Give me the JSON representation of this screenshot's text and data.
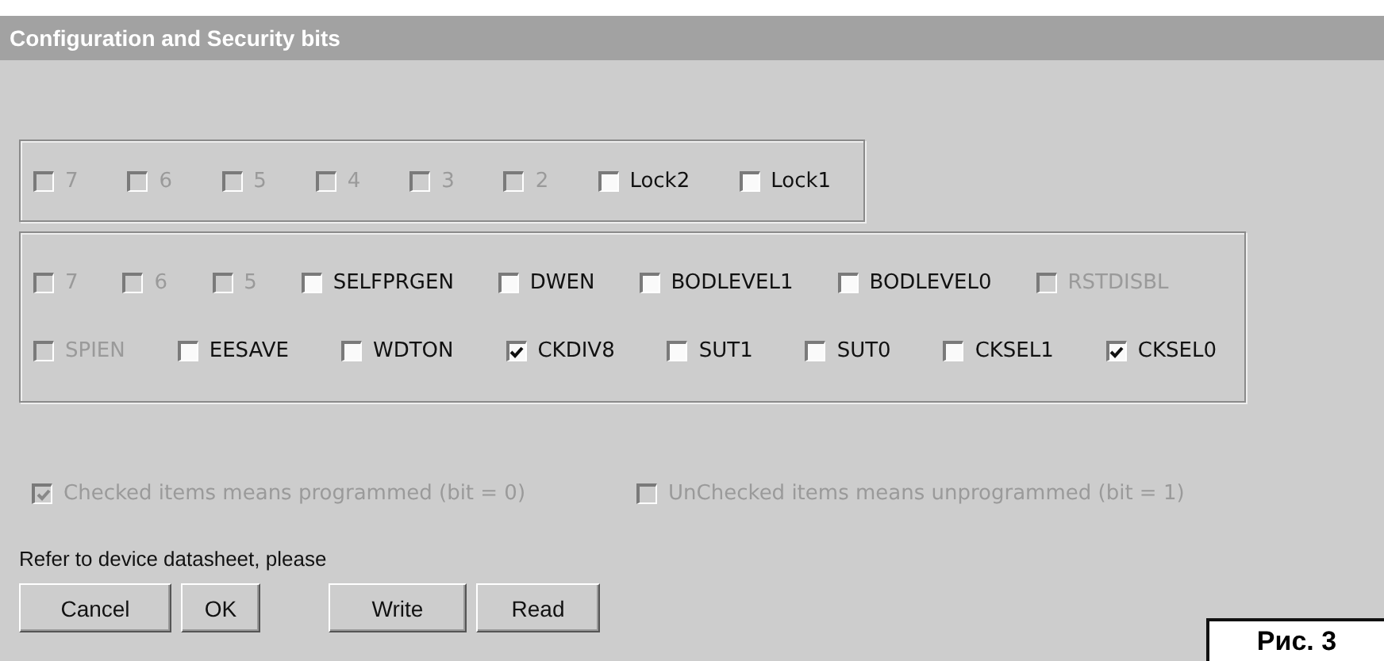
{
  "window": {
    "title": "Configuration and Security bits"
  },
  "lock_bits": [
    {
      "label": "7",
      "checked": false,
      "disabled": true
    },
    {
      "label": "6",
      "checked": false,
      "disabled": true
    },
    {
      "label": "5",
      "checked": false,
      "disabled": true
    },
    {
      "label": "4",
      "checked": false,
      "disabled": true
    },
    {
      "label": "3",
      "checked": false,
      "disabled": true
    },
    {
      "label": "2",
      "checked": false,
      "disabled": true
    },
    {
      "label": "Lock2",
      "checked": false,
      "disabled": false
    },
    {
      "label": "Lock1",
      "checked": false,
      "disabled": false
    }
  ],
  "fuse_rows": [
    [
      {
        "label": "7",
        "checked": false,
        "disabled": true
      },
      {
        "label": "6",
        "checked": false,
        "disabled": true
      },
      {
        "label": "5",
        "checked": false,
        "disabled": true
      },
      {
        "label": "SELFPRGEN",
        "checked": false,
        "disabled": false
      },
      {
        "label": "DWEN",
        "checked": false,
        "disabled": false
      },
      {
        "label": "BODLEVEL1",
        "checked": false,
        "disabled": false
      },
      {
        "label": "BODLEVEL0",
        "checked": false,
        "disabled": false
      },
      {
        "label": "RSTDISBL",
        "checked": false,
        "disabled": true
      }
    ],
    [
      {
        "label": "SPIEN",
        "checked": false,
        "disabled": true
      },
      {
        "label": "EESAVE",
        "checked": false,
        "disabled": false
      },
      {
        "label": "WDTON",
        "checked": false,
        "disabled": false
      },
      {
        "label": "CKDIV8",
        "checked": true,
        "disabled": false
      },
      {
        "label": "SUT1",
        "checked": false,
        "disabled": false
      },
      {
        "label": "SUT0",
        "checked": false,
        "disabled": false
      },
      {
        "label": "CKSEL1",
        "checked": false,
        "disabled": false
      },
      {
        "label": "CKSEL0",
        "checked": true,
        "disabled": false
      }
    ]
  ],
  "legend": [
    {
      "label": "Checked items means programmed (bit = 0)",
      "checked": true,
      "disabled": true
    },
    {
      "label": "UnChecked items means unprogrammed (bit = 1)",
      "checked": false,
      "disabled": true
    }
  ],
  "note": "Refer to device datasheet, please",
  "buttons": [
    "Cancel",
    "OK",
    "Write",
    "Read"
  ],
  "figure_caption": "Рис. 3"
}
